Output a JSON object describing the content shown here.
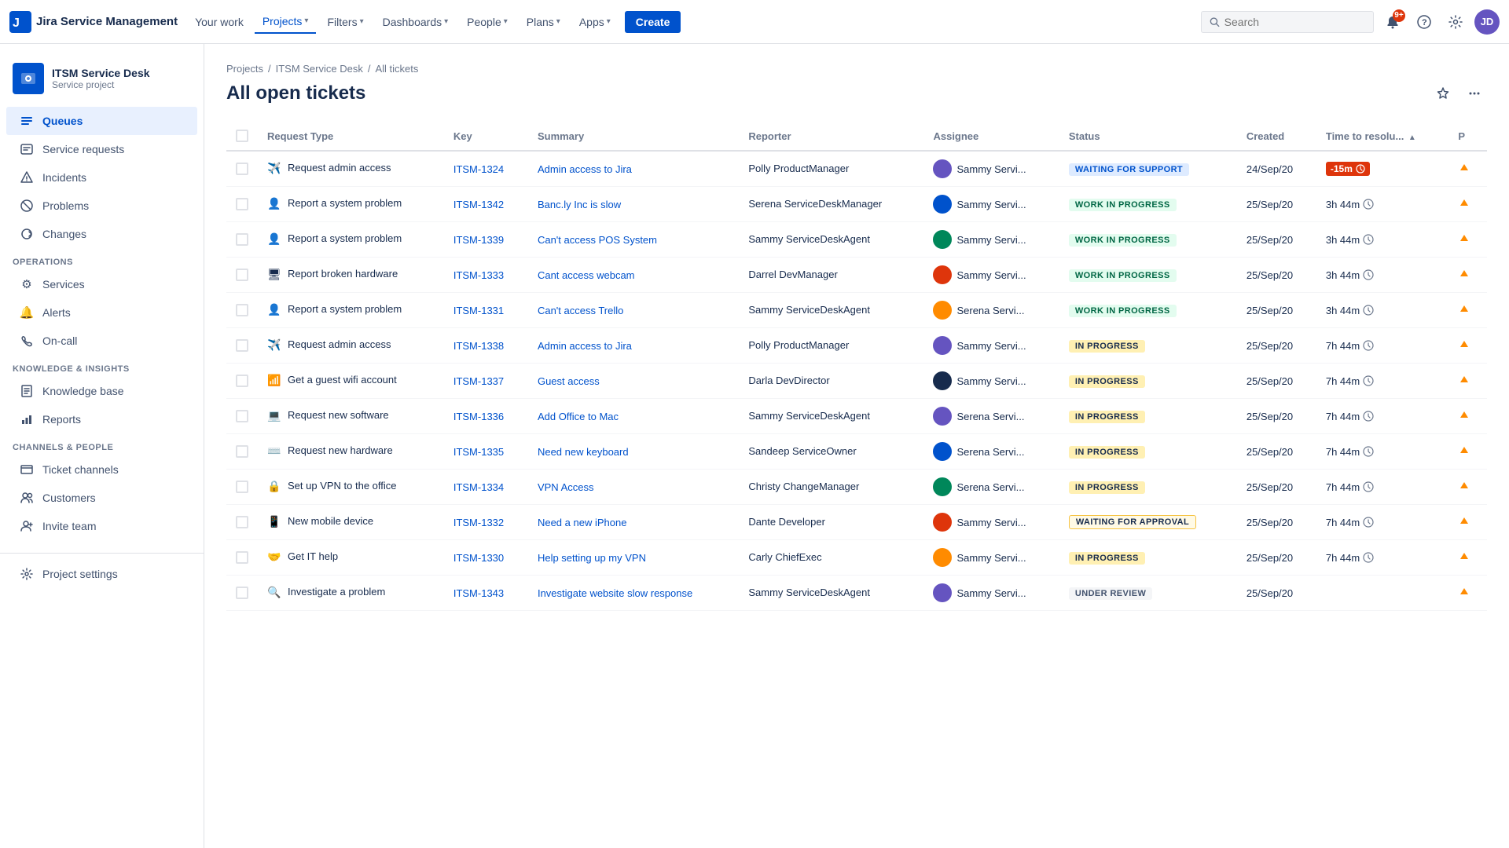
{
  "app": {
    "name": "Jira Service Management"
  },
  "topnav": {
    "logo_text": "Jira Service Management",
    "items": [
      {
        "label": "Your work",
        "active": false
      },
      {
        "label": "Projects",
        "active": true,
        "has_chevron": true
      },
      {
        "label": "Filters",
        "active": false,
        "has_chevron": true
      },
      {
        "label": "Dashboards",
        "active": false,
        "has_chevron": true
      },
      {
        "label": "People",
        "active": false,
        "has_chevron": true
      },
      {
        "label": "Plans",
        "active": false,
        "has_chevron": true
      },
      {
        "label": "Apps",
        "active": false,
        "has_chevron": true
      }
    ],
    "create_label": "Create",
    "search_placeholder": "Search",
    "notification_count": "9+"
  },
  "sidebar": {
    "project_name": "ITSM Service Desk",
    "project_type": "Service project",
    "nav": [
      {
        "id": "queues",
        "label": "Queues",
        "active": true,
        "icon": "☰"
      },
      {
        "id": "service-requests",
        "label": "Service requests",
        "active": false,
        "icon": "💬"
      },
      {
        "id": "incidents",
        "label": "Incidents",
        "active": false,
        "icon": "△"
      },
      {
        "id": "problems",
        "label": "Problems",
        "active": false,
        "icon": "⊘"
      },
      {
        "id": "changes",
        "label": "Changes",
        "active": false,
        "icon": "↻"
      }
    ],
    "sections": [
      {
        "label": "Operations",
        "items": [
          {
            "id": "services",
            "label": "Services",
            "icon": "⚙"
          },
          {
            "id": "alerts",
            "label": "Alerts",
            "icon": "🔔"
          },
          {
            "id": "on-call",
            "label": "On-call",
            "icon": "📞"
          }
        ]
      },
      {
        "label": "Knowledge & Insights",
        "items": [
          {
            "id": "knowledge-base",
            "label": "Knowledge base",
            "icon": "📖"
          },
          {
            "id": "reports",
            "label": "Reports",
            "icon": "📊"
          }
        ]
      },
      {
        "label": "Channels & People",
        "items": [
          {
            "id": "ticket-channels",
            "label": "Ticket channels",
            "icon": "🖥"
          },
          {
            "id": "customers",
            "label": "Customers",
            "icon": "👥"
          },
          {
            "id": "invite-team",
            "label": "Invite team",
            "icon": "👤"
          }
        ]
      }
    ],
    "project_settings_label": "Project settings"
  },
  "breadcrumb": {
    "items": [
      "Projects",
      "ITSM Service Desk",
      "All tickets"
    ]
  },
  "page": {
    "title": "All open tickets"
  },
  "table": {
    "columns": [
      {
        "id": "request-type",
        "label": "Request Type"
      },
      {
        "id": "key",
        "label": "Key"
      },
      {
        "id": "summary",
        "label": "Summary"
      },
      {
        "id": "reporter",
        "label": "Reporter"
      },
      {
        "id": "assignee",
        "label": "Assignee"
      },
      {
        "id": "status",
        "label": "Status"
      },
      {
        "id": "created",
        "label": "Created"
      },
      {
        "id": "time-to-resolution",
        "label": "Time to resolu..."
      },
      {
        "id": "priority",
        "label": "P"
      }
    ],
    "rows": [
      {
        "id": 1,
        "request_type_icon": "✈️",
        "request_type_label": "Request admin access",
        "key": "ITSM-1324",
        "summary": "Admin access to Jira",
        "reporter": "Polly ProductManager",
        "assignee_name": "Sammy Servi...",
        "status": "WAITING FOR SUPPORT",
        "status_class": "status-waiting-support",
        "created": "24/Sep/20",
        "time": "-15m",
        "time_overdue": true,
        "priority_high": true
      },
      {
        "id": 2,
        "request_type_icon": "👤",
        "request_type_label": "Report a system problem",
        "key": "ITSM-1342",
        "summary": "Banc.ly Inc is slow",
        "reporter": "Serena ServiceDeskManager",
        "assignee_name": "Sammy Servi...",
        "status": "WORK IN PROGRESS",
        "status_class": "status-work-in-progress",
        "created": "25/Sep/20",
        "time": "3h 44m",
        "time_overdue": false,
        "priority_high": true
      },
      {
        "id": 3,
        "request_type_icon": "👤",
        "request_type_label": "Report a system problem",
        "key": "ITSM-1339",
        "summary": "Can't access POS System",
        "reporter": "Sammy ServiceDeskAgent",
        "assignee_name": "Sammy Servi...",
        "status": "WORK IN PROGRESS",
        "status_class": "status-work-in-progress",
        "created": "25/Sep/20",
        "time": "3h 44m",
        "time_overdue": false,
        "priority_high": true
      },
      {
        "id": 4,
        "request_type_icon": "🖥",
        "request_type_label": "Report broken hardware",
        "key": "ITSM-1333",
        "summary": "Cant access webcam",
        "reporter": "Darrel DevManager",
        "assignee_name": "Sammy Servi...",
        "status": "WORK IN PROGRESS",
        "status_class": "status-work-in-progress",
        "created": "25/Sep/20",
        "time": "3h 44m",
        "time_overdue": false,
        "priority_high": true
      },
      {
        "id": 5,
        "request_type_icon": "👤",
        "request_type_label": "Report a system problem",
        "key": "ITSM-1331",
        "summary": "Can't access Trello",
        "reporter": "Sammy ServiceDeskAgent",
        "assignee_name": "Serena Servi...",
        "status": "WORK IN PROGRESS",
        "status_class": "status-work-in-progress",
        "created": "25/Sep/20",
        "time": "3h 44m",
        "time_overdue": false,
        "priority_high": true
      },
      {
        "id": 6,
        "request_type_icon": "✈️",
        "request_type_label": "Request admin access",
        "key": "ITSM-1338",
        "summary": "Admin access to Jira",
        "reporter": "Polly ProductManager",
        "assignee_name": "Sammy Servi...",
        "status": "IN PROGRESS",
        "status_class": "status-in-progress",
        "created": "25/Sep/20",
        "time": "7h 44m",
        "time_overdue": false,
        "priority_high": true
      },
      {
        "id": 7,
        "request_type_icon": "📶",
        "request_type_label": "Get a guest wifi account",
        "key": "ITSM-1337",
        "summary": "Guest access",
        "reporter": "Darla DevDirector",
        "assignee_name": "Sammy Servi...",
        "status": "IN PROGRESS",
        "status_class": "status-in-progress",
        "created": "25/Sep/20",
        "time": "7h 44m",
        "time_overdue": false,
        "priority_high": true
      },
      {
        "id": 8,
        "request_type_icon": "💻",
        "request_type_label": "Request new software",
        "key": "ITSM-1336",
        "summary": "Add Office to Mac",
        "reporter": "Sammy ServiceDeskAgent",
        "assignee_name": "Serena Servi...",
        "status": "IN PROGRESS",
        "status_class": "status-in-progress",
        "created": "25/Sep/20",
        "time": "7h 44m",
        "time_overdue": false,
        "priority_high": true
      },
      {
        "id": 9,
        "request_type_icon": "⌨️",
        "request_type_label": "Request new hardware",
        "key": "ITSM-1335",
        "summary": "Need new keyboard",
        "reporter": "Sandeep ServiceOwner",
        "assignee_name": "Serena Servi...",
        "status": "IN PROGRESS",
        "status_class": "status-in-progress",
        "created": "25/Sep/20",
        "time": "7h 44m",
        "time_overdue": false,
        "priority_high": true
      },
      {
        "id": 10,
        "request_type_icon": "🔒",
        "request_type_label": "Set up VPN to the office",
        "key": "ITSM-1334",
        "summary": "VPN Access",
        "reporter": "Christy ChangeManager",
        "assignee_name": "Serena Servi...",
        "status": "IN PROGRESS",
        "status_class": "status-in-progress",
        "created": "25/Sep/20",
        "time": "7h 44m",
        "time_overdue": false,
        "priority_high": true
      },
      {
        "id": 11,
        "request_type_icon": "📱",
        "request_type_label": "New mobile device",
        "key": "ITSM-1332",
        "summary": "Need a new iPhone",
        "reporter": "Dante Developer",
        "assignee_name": "Sammy Servi...",
        "status": "WAITING FOR APPROVAL",
        "status_class": "status-waiting-approval",
        "created": "25/Sep/20",
        "time": "7h 44m",
        "time_overdue": false,
        "priority_high": true
      },
      {
        "id": 12,
        "request_type_icon": "🤝",
        "request_type_label": "Get IT help",
        "key": "ITSM-1330",
        "summary": "Help setting up my VPN",
        "reporter": "Carly ChiefExec",
        "assignee_name": "Sammy Servi...",
        "status": "IN PROGRESS",
        "status_class": "status-in-progress",
        "created": "25/Sep/20",
        "time": "7h 44m",
        "time_overdue": false,
        "priority_high": true
      },
      {
        "id": 13,
        "request_type_icon": "🔍",
        "request_type_label": "Investigate a problem",
        "key": "ITSM-1343",
        "summary": "Investigate website slow response",
        "reporter": "Sammy ServiceDeskAgent",
        "assignee_name": "Sammy Servi...",
        "status": "UNDER REVIEW",
        "status_class": "status-under-review",
        "created": "25/Sep/20",
        "time": "",
        "time_overdue": false,
        "priority_high": true
      }
    ]
  }
}
